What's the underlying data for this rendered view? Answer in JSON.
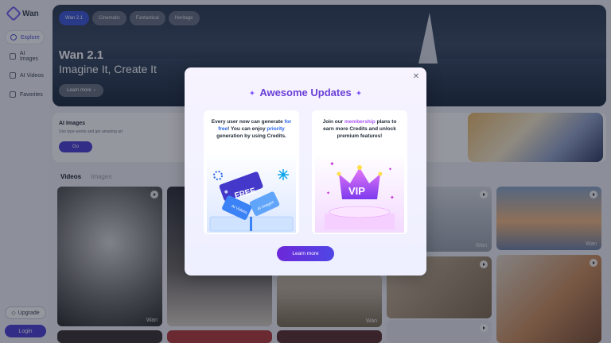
{
  "app": {
    "name": "Wan"
  },
  "sidebar": {
    "items": [
      {
        "label": "Explore",
        "icon": "compass-icon",
        "active": true
      },
      {
        "label": "AI Images",
        "icon": "image-icon",
        "active": false
      },
      {
        "label": "AI Videos",
        "icon": "video-icon",
        "active": false
      },
      {
        "label": "Favorites",
        "icon": "star-icon",
        "active": false
      }
    ],
    "upgrade_label": "Upgrade",
    "login_label": "Login"
  },
  "hero": {
    "tabs": [
      {
        "label": "Wan 2.1",
        "active": true
      },
      {
        "label": "Cinematic",
        "active": false
      },
      {
        "label": "Fantastical",
        "active": false
      },
      {
        "label": "Heritage",
        "active": false
      }
    ],
    "title": "Wan 2.1",
    "subtitle": "Imagine It, Create It",
    "learn_more": "Learn more"
  },
  "ai_images": {
    "title": "AI Images",
    "description": "Use type words and get amazing art",
    "go_label": "Go"
  },
  "media_tabs": [
    {
      "label": "Videos",
      "active": true
    },
    {
      "label": "Images",
      "active": false
    }
  ],
  "thumbnails": {
    "watermark": "Wan"
  },
  "modal": {
    "title": "Awesome Updates",
    "close_icon": "close-icon",
    "left_card": {
      "text_1": "Every user now can generate ",
      "highlight_1": "for free",
      "text_2": "! You can enjoy ",
      "highlight_2": "priority",
      "text_3": " generation by using Credits.",
      "tag_free": "FREE",
      "tag_ai_videos": "AI Videos",
      "tag_ai_images": "AI Images"
    },
    "right_card": {
      "text_1": "Join our ",
      "highlight_1": "membership",
      "text_2": " plans to earn more Credits and unlock premium features!",
      "badge": "VIP"
    },
    "learn_more": "Learn more"
  },
  "colors": {
    "accent": "#4c3fd6",
    "modal_title": "#6a3fd6",
    "highlight_blue": "#2563eb",
    "highlight_purple": "#a855f7"
  }
}
